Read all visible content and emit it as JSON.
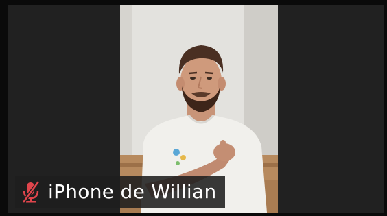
{
  "participant": {
    "name": "iPhone de Willian",
    "muted": true,
    "mic_icon": "microphone-muted-icon"
  },
  "colors": {
    "tile_background": "#212121",
    "muted_icon": "#e0454c",
    "name_text": "#ffffff"
  }
}
